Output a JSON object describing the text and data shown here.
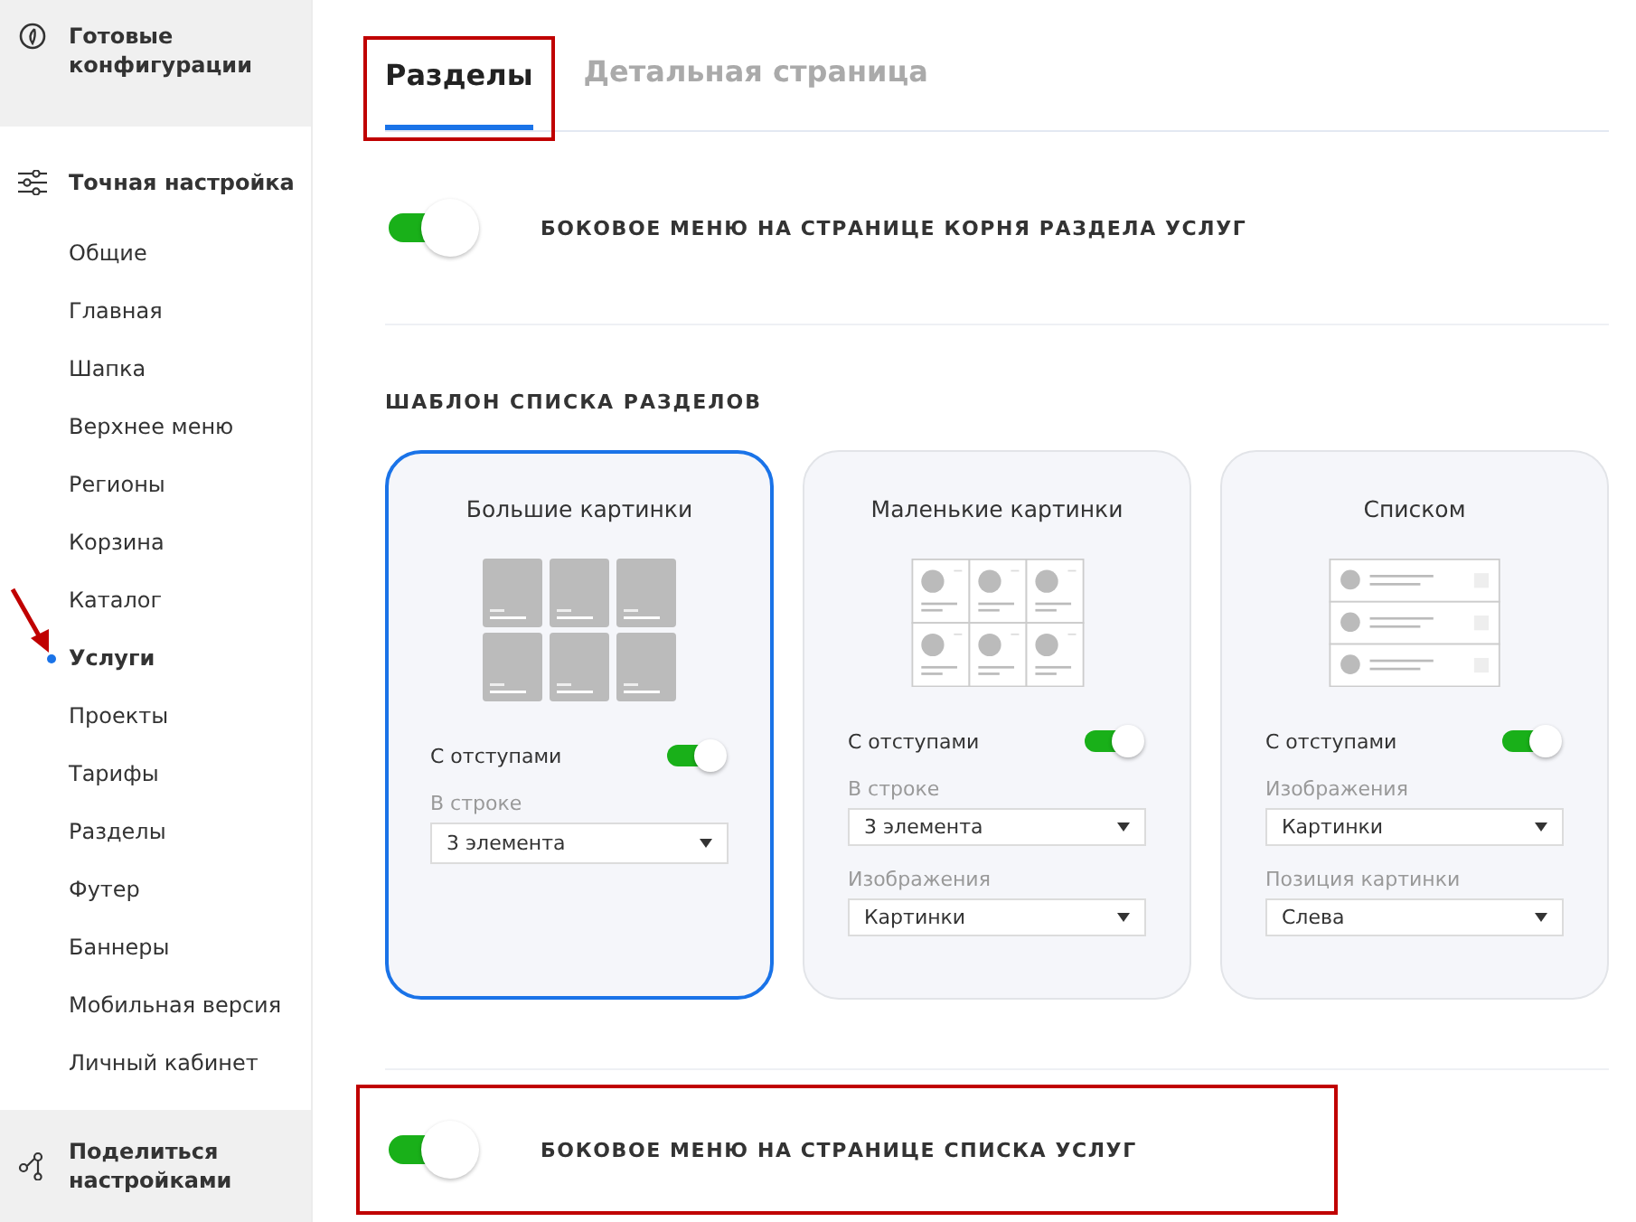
{
  "sidebar": {
    "top_item": {
      "label": "Готовые конфигурации"
    },
    "section": {
      "label": "Точная настройка"
    },
    "items": [
      {
        "label": "Общие",
        "selected": false,
        "annotated": false
      },
      {
        "label": "Главная",
        "selected": false,
        "annotated": false
      },
      {
        "label": "Шапка",
        "selected": false,
        "annotated": false
      },
      {
        "label": "Верхнее меню",
        "selected": false,
        "annotated": false
      },
      {
        "label": "Регионы",
        "selected": false,
        "annotated": false
      },
      {
        "label": "Корзина",
        "selected": false,
        "annotated": false
      },
      {
        "label": "Каталог",
        "selected": false,
        "annotated": false
      },
      {
        "label": "Услуги",
        "selected": true,
        "annotated": true
      },
      {
        "label": "Проекты",
        "selected": false,
        "annotated": false
      },
      {
        "label": "Тарифы",
        "selected": false,
        "annotated": false
      },
      {
        "label": "Разделы",
        "selected": false,
        "annotated": false
      },
      {
        "label": "Футер",
        "selected": false,
        "annotated": false
      },
      {
        "label": "Баннеры",
        "selected": false,
        "annotated": false
      },
      {
        "label": "Мобильная версия",
        "selected": false,
        "annotated": false
      },
      {
        "label": "Личный кабинет",
        "selected": false,
        "annotated": false
      }
    ],
    "bottom_item": {
      "label": "Поделиться настройками"
    }
  },
  "tabs": [
    {
      "label": "Разделы",
      "selected": true,
      "highlighted": true
    },
    {
      "label": "Детальная страница",
      "selected": false,
      "highlighted": false
    }
  ],
  "top_toggle": {
    "label": "БОКОВОЕ МЕНЮ НА СТРАНИЦЕ КОРНЯ РАЗДЕЛА УСЛУГ",
    "on": true,
    "highlighted": false
  },
  "template": {
    "heading": "ШАБЛОН СПИСКА РАЗДЕЛОВ",
    "cards": [
      {
        "title": "Большие картинки",
        "kind": "large",
        "selected": true,
        "toggle": {
          "label": "С отступами",
          "on": true
        },
        "fields": [
          {
            "label": "В строке",
            "value": "3 элемента"
          }
        ]
      },
      {
        "title": "Маленькие картинки",
        "kind": "small",
        "selected": false,
        "toggle": {
          "label": "С отступами",
          "on": true
        },
        "fields": [
          {
            "label": "В строке",
            "value": "3 элемента"
          },
          {
            "label": "Изображения",
            "value": "Картинки"
          }
        ]
      },
      {
        "title": "Списком",
        "kind": "list",
        "selected": false,
        "toggle": {
          "label": "С отступами",
          "on": true
        },
        "fields": [
          {
            "label": "Изображения",
            "value": "Картинки"
          },
          {
            "label": "Позиция картинки",
            "value": "Слева"
          }
        ]
      }
    ]
  },
  "bottom_toggle": {
    "label": "БОКОВОЕ МЕНЮ НА СТРАНИЦЕ СПИСКА УСЛУГ",
    "on": true,
    "highlighted": true
  }
}
